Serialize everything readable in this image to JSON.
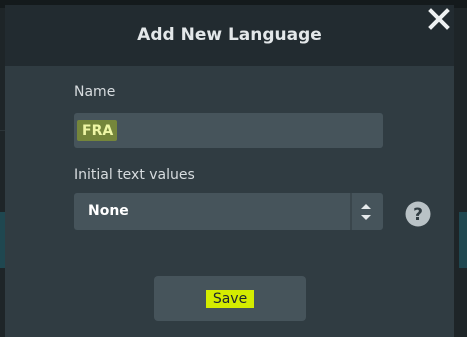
{
  "dialog": {
    "title": "Add New Language",
    "close_icon": "close-icon"
  },
  "form": {
    "name_label": "Name",
    "name_value": "FRA",
    "initial_label": "Initial text values",
    "initial_selected": "None",
    "select_icon": "updown-chevron-icon",
    "help_icon": "question-circle-icon"
  },
  "actions": {
    "save_label": "Save"
  },
  "colors": {
    "dialog_body": "#303c42",
    "dialog_header": "#222b30",
    "field_bg": "#46545b",
    "highlight": "#d8f000"
  }
}
